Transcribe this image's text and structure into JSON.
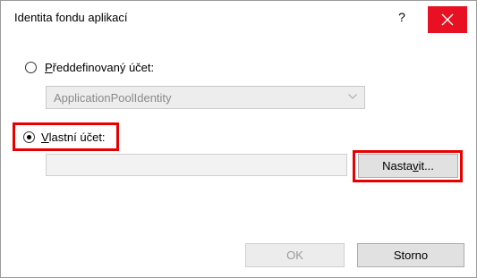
{
  "dialog": {
    "title": "Identita fondu aplikací",
    "help_label": "?",
    "close_label": "close",
    "close_color": "#e81123"
  },
  "predefined": {
    "label": "Předdefinovaný účet:",
    "label_underline": "P",
    "label_rest": "ředdefinovaný účet:",
    "selected": false,
    "dropdown_value": "ApplicationPoolIdentity"
  },
  "custom": {
    "label_underline": "V",
    "label_rest": "lastní účet:",
    "selected": true,
    "value": "",
    "set_button_pre": "Nasta",
    "set_button_ul": "v",
    "set_button_post": "it..."
  },
  "footer": {
    "ok_label": "OK",
    "ok_enabled": false,
    "cancel_label": "Storno"
  },
  "highlight_color": "#e80000"
}
